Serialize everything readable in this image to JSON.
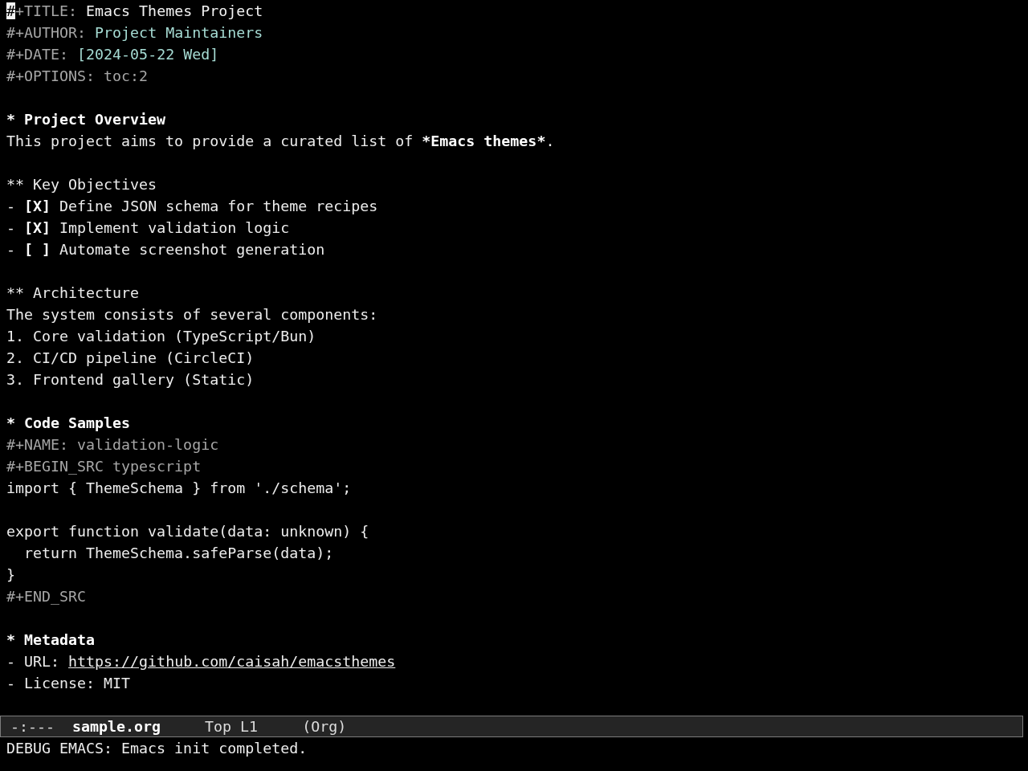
{
  "document": {
    "keywords": [
      {
        "key": "#+TITLE:",
        "value": "Emacs Themes Project",
        "kind": "title",
        "cursor": true
      },
      {
        "key": "#+AUTHOR:",
        "value": "Project Maintainers",
        "kind": "info",
        "cursor": false
      },
      {
        "key": "#+DATE:",
        "value": "[2024-05-22 Wed]",
        "kind": "info",
        "cursor": false
      },
      {
        "key": "#+OPTIONS:",
        "value": "toc:2",
        "kind": "meta",
        "cursor": false
      }
    ],
    "sections": [
      {
        "heading": "* Project Overview",
        "body": [
          {
            "kind": "paragraph",
            "segments": [
              {
                "text": "This project aims to provide a curated list of ",
                "bold": false
              },
              {
                "text": "*Emacs themes*",
                "bold": true
              },
              {
                "text": ".",
                "bold": false
              }
            ]
          }
        ],
        "children": [
          {
            "heading": "** Key Objectives",
            "body": [
              {
                "kind": "checklist",
                "items": [
                  {
                    "bullet": "-",
                    "checkbox": "[X]",
                    "text": "Define JSON schema for theme recipes"
                  },
                  {
                    "bullet": "-",
                    "checkbox": "[X]",
                    "text": "Implement validation logic"
                  },
                  {
                    "bullet": "-",
                    "checkbox": "[ ]",
                    "text": "Automate screenshot generation"
                  }
                ]
              }
            ]
          },
          {
            "heading": "** Architecture",
            "body": [
              {
                "kind": "paragraph",
                "segments": [
                  {
                    "text": "The system consists of several components:",
                    "bold": false
                  }
                ]
              },
              {
                "kind": "ordered_list",
                "items": [
                  "1. Core validation (TypeScript/Bun)",
                  "2. CI/CD pipeline (CircleCI)",
                  "3. Frontend gallery (Static)"
                ]
              }
            ]
          }
        ]
      },
      {
        "heading": "* Code Samples",
        "body": [
          {
            "kind": "src_block",
            "name_line": "#+NAME: validation-logic",
            "begin_line": "#+BEGIN_SRC typescript",
            "code": "import { ThemeSchema } from './schema';\n\nexport function validate(data: unknown) {\n  return ThemeSchema.safeParse(data);\n}",
            "end_line": "#+END_SRC"
          }
        ]
      },
      {
        "heading": "* Metadata",
        "body": [
          {
            "kind": "bullet_list",
            "items": [
              {
                "text": "- URL:",
                "link": "https://github.com/caisah/emacsthemes"
              },
              {
                "text": "- License: MIT"
              }
            ]
          }
        ]
      }
    ]
  },
  "mode_line": {
    "status": "-:---",
    "buffer_name": "sample.org",
    "position": "Top L1",
    "mode": "(Org)"
  },
  "echo_area": {
    "message": "DEBUG EMACS: Emacs init completed."
  }
}
